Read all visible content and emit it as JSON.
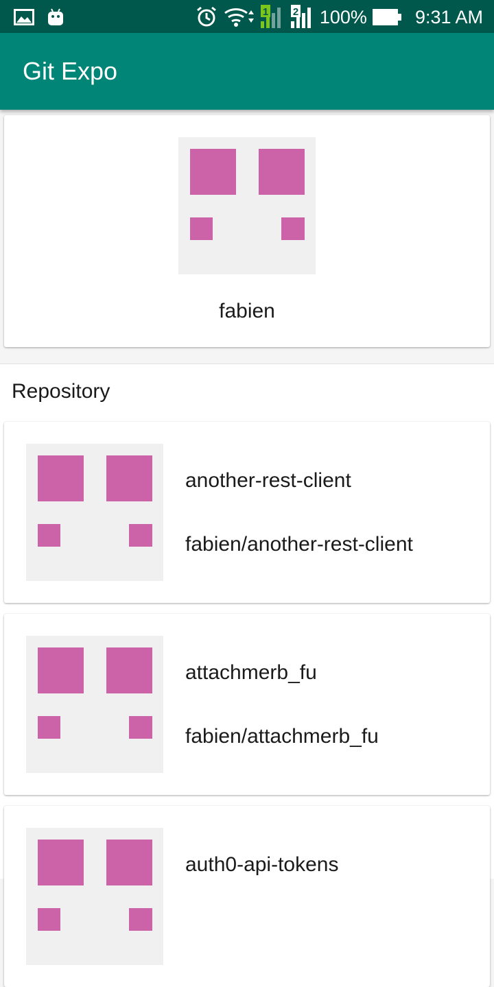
{
  "status_bar": {
    "icons_left": [
      "image-icon",
      "android-icon"
    ],
    "icons_right": [
      "alarm-icon",
      "wifi-icon",
      "sim1-signal-icon",
      "sim2-signal-icon",
      "battery-icon"
    ],
    "sim1_label": "1",
    "sim2_label": "2",
    "battery": "100%",
    "time": "9:31 AM",
    "color": "#00574b"
  },
  "app_bar": {
    "title": "Git Expo",
    "color": "#008577"
  },
  "profile": {
    "username": "fabien",
    "avatar_icon": "identicon",
    "identicon_color": "#cc63a9"
  },
  "repositories": {
    "section_title": "Repository",
    "items": [
      {
        "name": "another-rest-client",
        "full_name": "fabien/another-rest-client"
      },
      {
        "name": "attachmerb_fu",
        "full_name": "fabien/attachmerb_fu"
      },
      {
        "name": "auth0-api-tokens"
      }
    ]
  }
}
